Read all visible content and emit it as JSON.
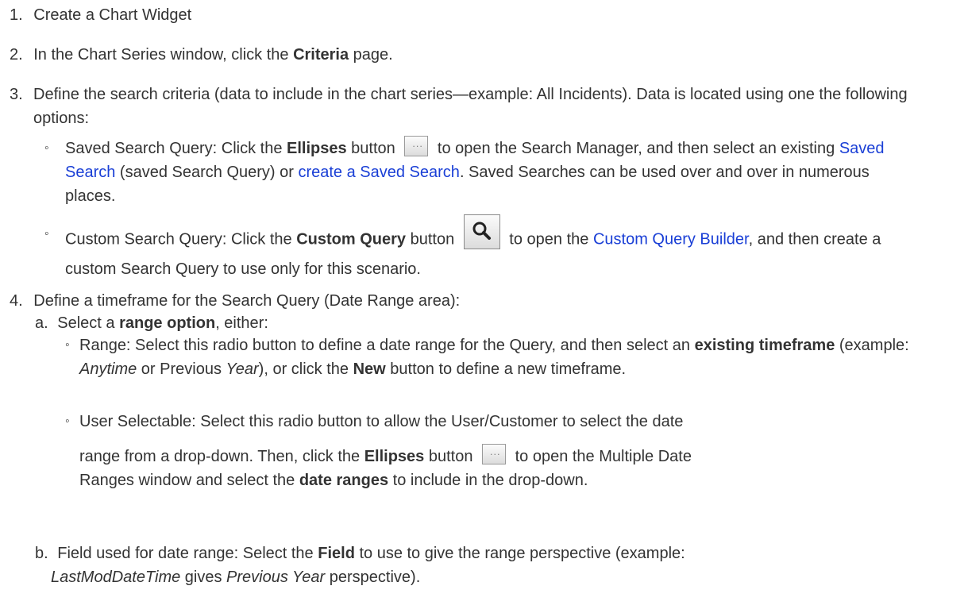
{
  "step1": {
    "num": "1.",
    "text": "Create a Chart Widget"
  },
  "step2": {
    "num": "2.",
    "pre": "In the Chart Series window, click the ",
    "bold": "Criteria",
    "post": " page."
  },
  "step3": {
    "num": "3.",
    "text": "Define the search criteria (data to include in the chart series—example: All Incidents). Data is located using one the following options:",
    "saved": {
      "bullet": "◦",
      "pre": "Saved Search Query: Click the ",
      "bold": "Ellipses",
      "mid": " button ",
      "post1": " to open the Search Manager, and then select an existing ",
      "link1": "Saved Search",
      "post2": " (saved Search Query) or ",
      "link2": "create a Saved Search",
      "post3": ". Saved Searches can be used over and over in numerous places."
    },
    "custom": {
      "bullet": "◦",
      "pre": "Custom Search Query: Click the ",
      "bold": "Custom Query",
      "mid": " button ",
      "post1": " to open the ",
      "link1": "Custom Query Builder",
      "post2": ", and then create a custom Search Query to use only for this scenario."
    }
  },
  "step4": {
    "num": "4.",
    "text": "Define a timeframe for the Search Query (Date Range area):",
    "a": {
      "label": "a.",
      "pre": "Select a ",
      "bold": "range option",
      "post": ", either:",
      "range": {
        "bullet": "◦",
        "pre": "Range: Select this radio button to define a date range for the Query, and then select an ",
        "bold1": "existing timeframe",
        "t1": " (example: ",
        "ital1": "Anytime",
        "t2": " or Previous ",
        "ital2": "Year",
        "t3": "), or click the ",
        "bold2": "New",
        "t4": " button to define a new timeframe."
      },
      "user": {
        "bullet": "◦",
        "line1": "User Selectable: Select this radio button to allow the User/Customer to select the date",
        "pre": "range from a drop-down. Then, click the ",
        "bold1": "Ellipses",
        "mid": " button ",
        "post1": " to open the Multiple Date",
        "line3pre": "Ranges window and select the ",
        "bold2": "date ranges",
        "line3post": " to include in the drop-down."
      }
    },
    "b": {
      "label": "b.",
      "pre": "Field used for date range: Select the ",
      "bold": "Field",
      "post1": " to use to give the range perspective (example:",
      "ital1": "LastModDateTime",
      "mid": " gives ",
      "ital2": "Previous Year",
      "post2": " perspective)."
    }
  },
  "icons": {
    "ellipsis": "ellipsis-icon",
    "search": "search-icon"
  }
}
